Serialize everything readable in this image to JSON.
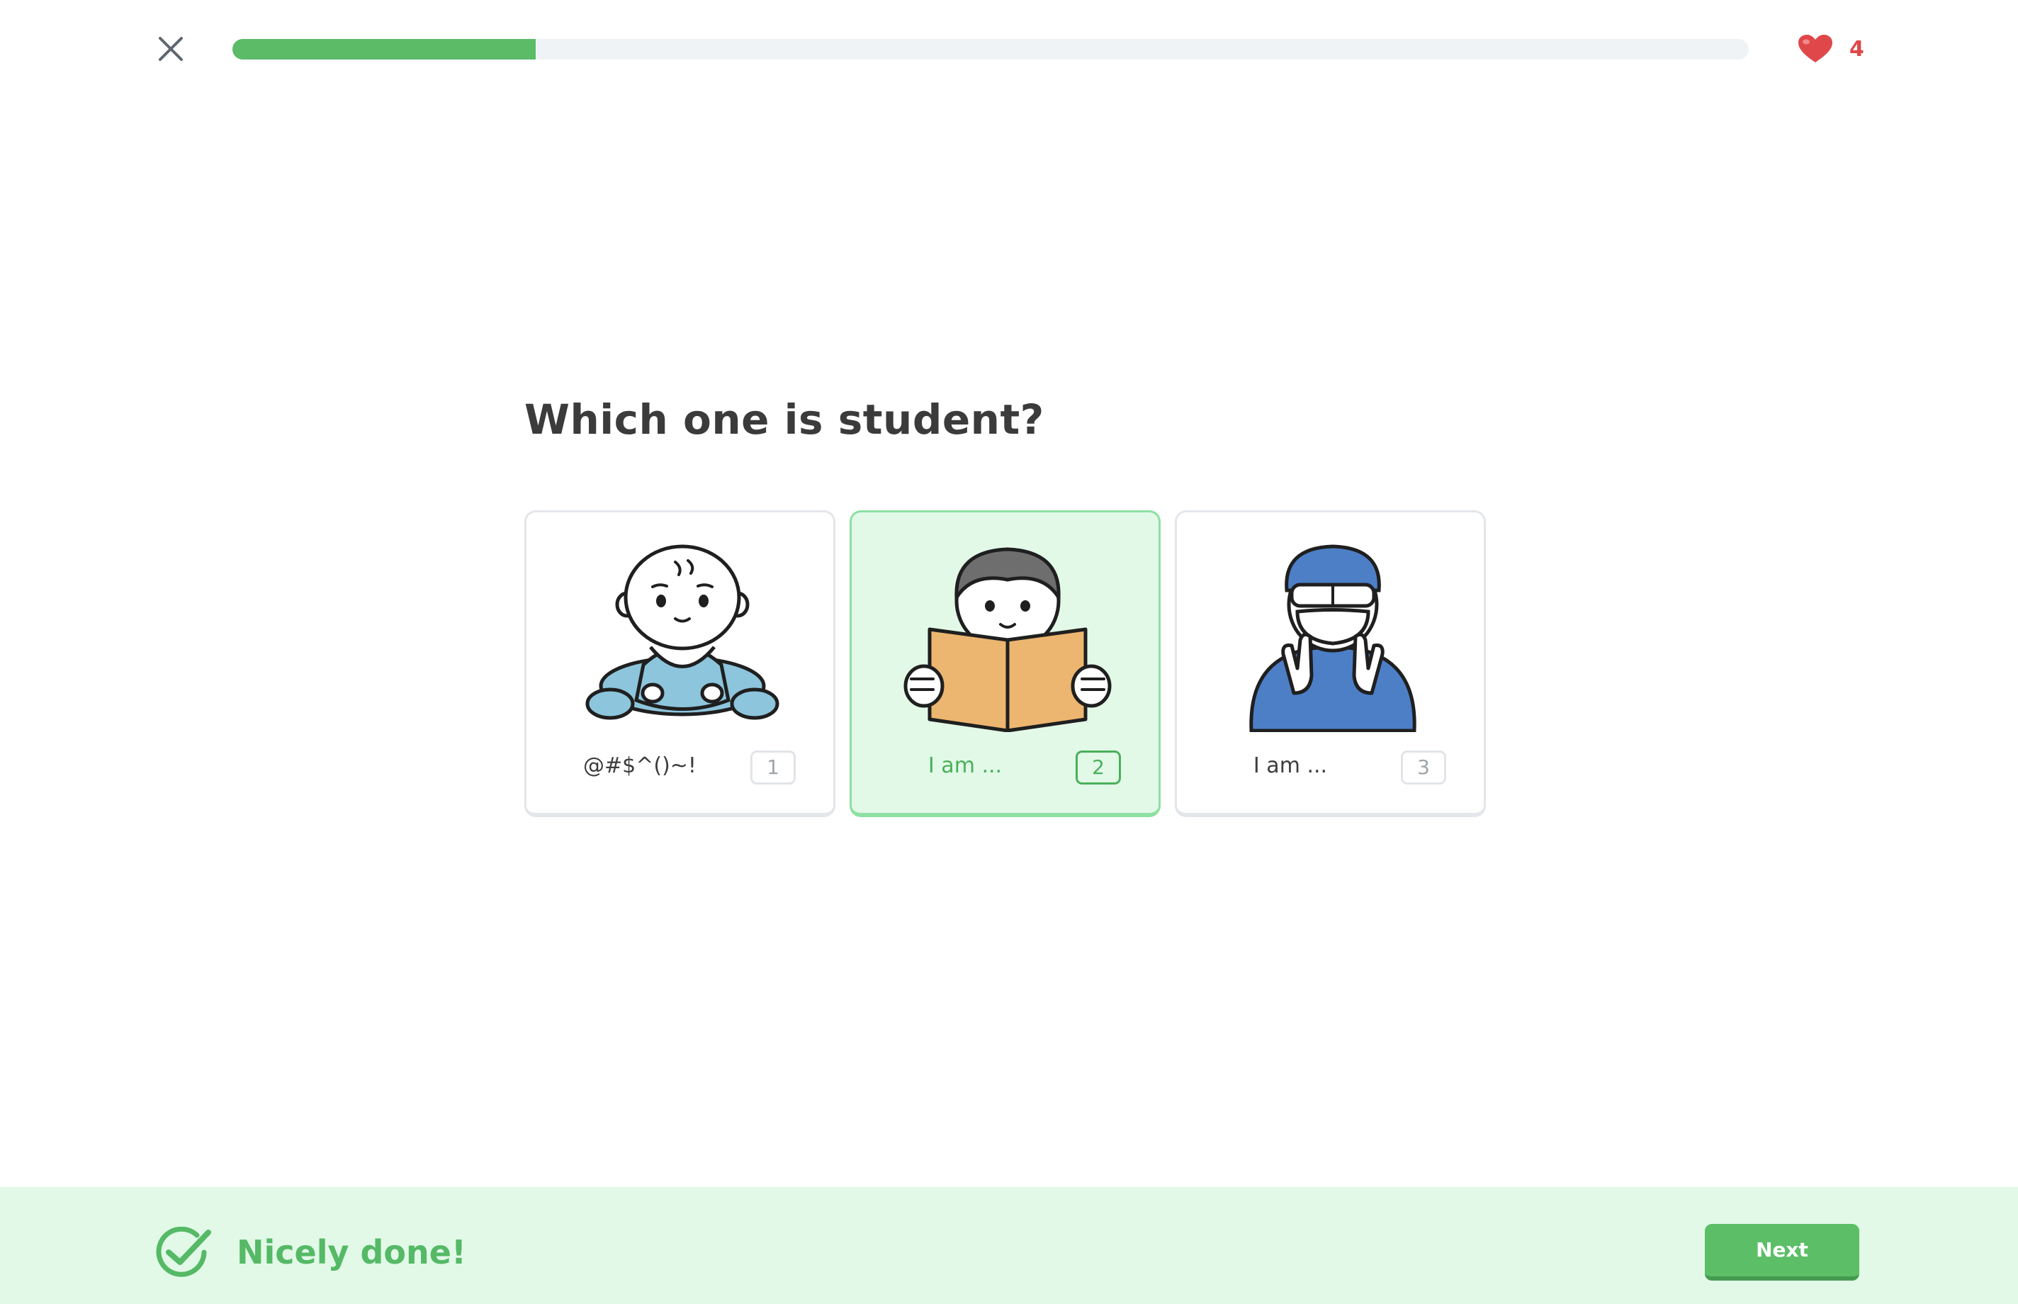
{
  "header": {
    "close_icon": "close-icon",
    "progress": 0.2,
    "hearts": {
      "icon": "heart-icon",
      "count": "4"
    }
  },
  "question": {
    "text": "Which one is student?"
  },
  "options": [
    {
      "label": "@#$^()~!",
      "number": "1",
      "illustration": "baby-illustration",
      "selected": false
    },
    {
      "label": "I am ...",
      "number": "2",
      "illustration": "student-reading-illustration",
      "selected": true
    },
    {
      "label": "I am ...",
      "number": "3",
      "illustration": "worker-in-mask-illustration",
      "selected": false
    }
  ],
  "feedback": {
    "icon": "check-circle-icon",
    "message": "Nicely done!"
  },
  "footer": {
    "next_label": "Next"
  },
  "colors": {
    "accent_green": "#5cbb67",
    "selected_bg": "#e2f9e8",
    "heart_red": "#e0474a",
    "text_dark": "#3b3b3b"
  }
}
